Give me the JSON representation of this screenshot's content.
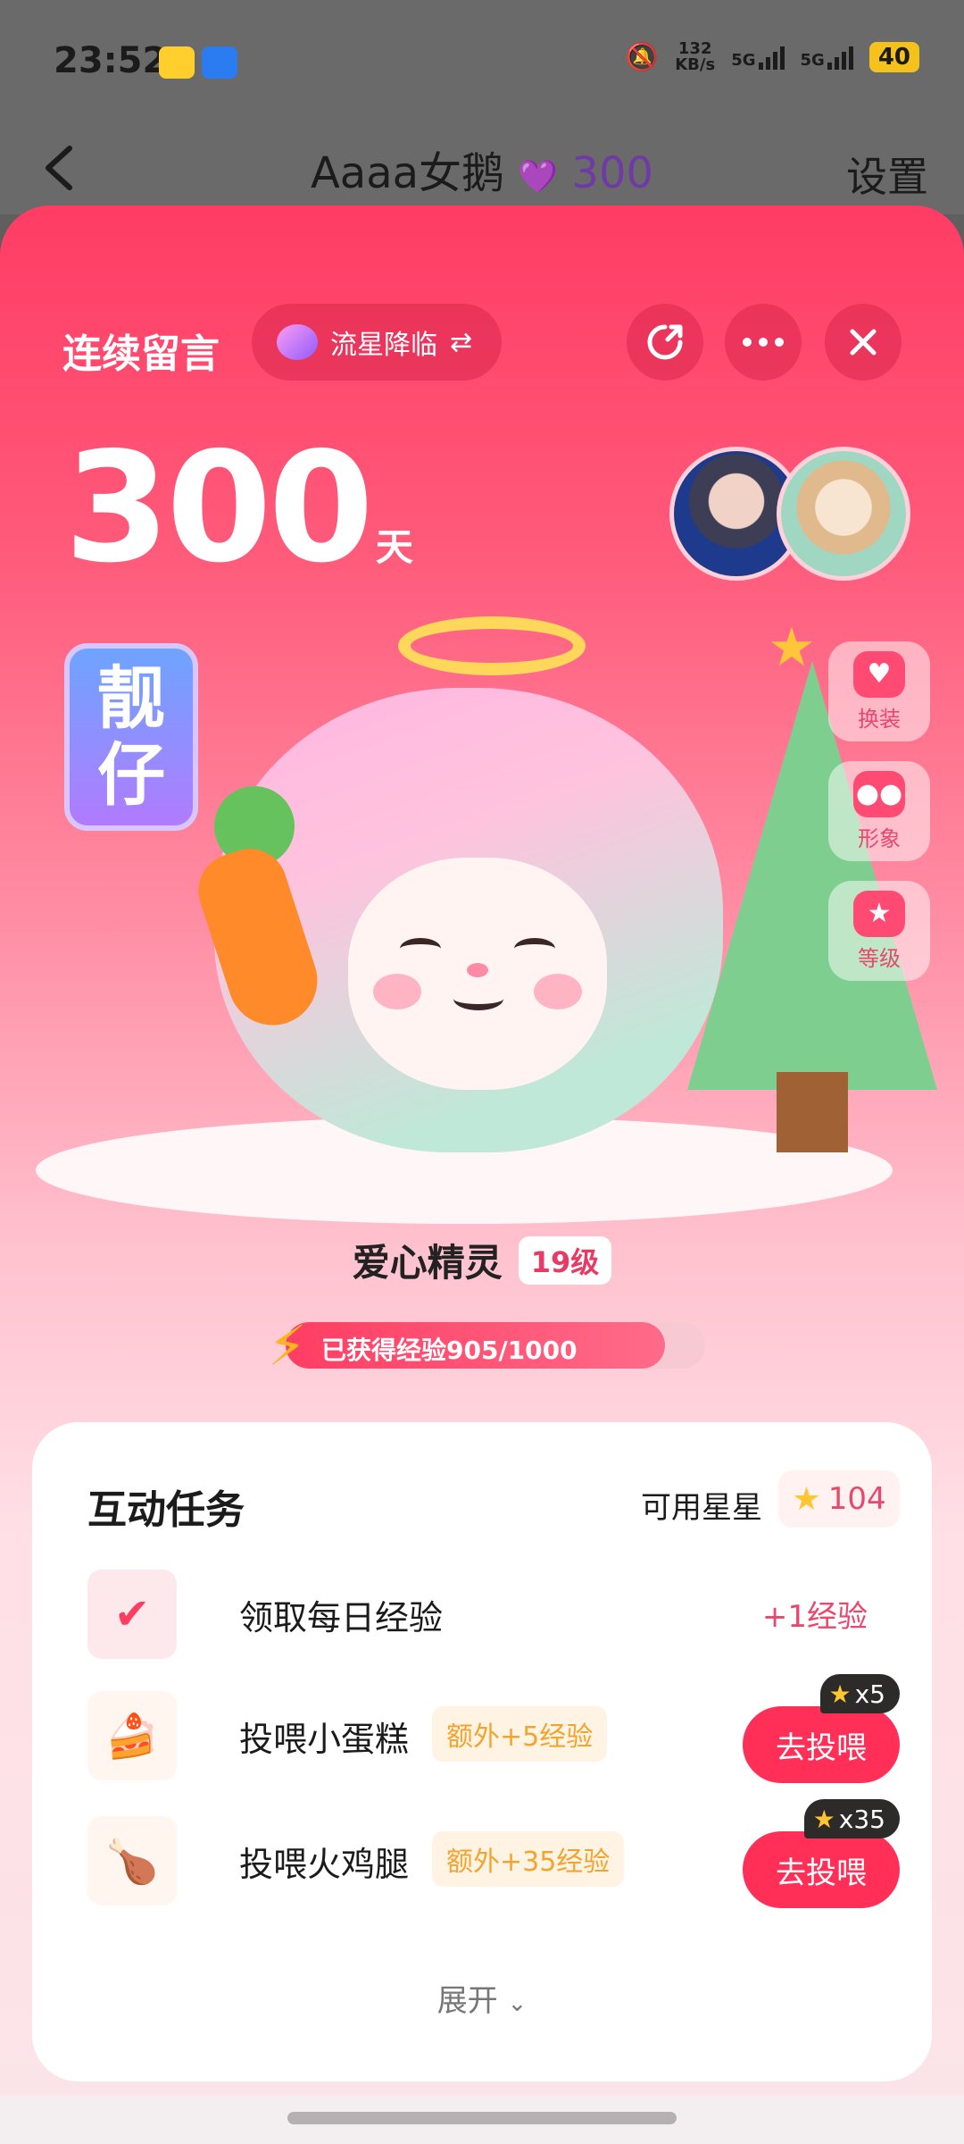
{
  "status_bar": {
    "time": "23:52",
    "speed_value": "132",
    "speed_unit": "KB/s",
    "net1": "5G",
    "net2": "5G",
    "battery": "40"
  },
  "nav": {
    "title": "Aaaa女鹅",
    "heart_icon": "purple-heart-icon",
    "title_count": "300",
    "settings": "设置"
  },
  "header": {
    "streak_label": "连续留言",
    "meteor_label": "流星降临",
    "meteor_switch": "⇄",
    "days": "300",
    "days_unit": "天"
  },
  "badge": {
    "line1": "靓",
    "line2": "仔"
  },
  "pet": {
    "name": "爱心精灵",
    "level": "19级",
    "xp_text": "已获得经验905/1000",
    "xp_fraction": 0.905
  },
  "side_buttons": [
    {
      "label": "换装",
      "icon": "outfit-icon"
    },
    {
      "label": "形象",
      "icon": "pig-face-icon"
    },
    {
      "label": "等级",
      "icon": "star-level-icon"
    }
  ],
  "tasks": {
    "title": "互动任务",
    "stars_label": "可用星星",
    "stars_count": "104",
    "items": [
      {
        "name": "领取每日经验",
        "reward": "+1经验"
      },
      {
        "name": "投喂小蛋糕",
        "extra": "额外+5经验",
        "button": "去投喂",
        "cost": "x5"
      },
      {
        "name": "投喂火鸡腿",
        "extra": "额外+35经验",
        "button": "去投喂",
        "cost": "x35"
      }
    ],
    "expand": "展开"
  },
  "colors": {
    "accent": "#ff2f58",
    "brand_pink": "#e8476e",
    "extra_orange": "#f3a42f"
  }
}
